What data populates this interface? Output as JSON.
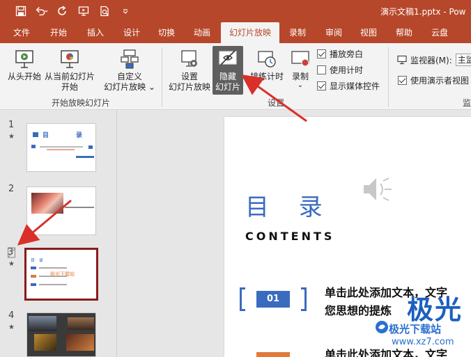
{
  "window": {
    "title": "演示文稿1.pptx  -  Pow"
  },
  "tabs": [
    {
      "label": "文件"
    },
    {
      "label": "开始"
    },
    {
      "label": "插入"
    },
    {
      "label": "设计"
    },
    {
      "label": "切换"
    },
    {
      "label": "动画"
    },
    {
      "label": "幻灯片放映",
      "active": true
    },
    {
      "label": "录制"
    },
    {
      "label": "审阅"
    },
    {
      "label": "视图"
    },
    {
      "label": "帮助"
    },
    {
      "label": "云盘"
    }
  ],
  "ribbon": {
    "from_start": "从头开始",
    "from_current_line1": "从当前幻灯片",
    "from_current_line2": "开始",
    "custom_line1": "自定义",
    "custom_line2": "幻灯片放映 ⌄",
    "group_start_label": "开始放映幻灯片",
    "setup_line1": "设置",
    "setup_line2": "幻灯片放映",
    "hide_line1": "隐藏",
    "hide_line2": "幻灯片",
    "rehearse": "排练计时",
    "record": "录制",
    "record_arrow": "⌄",
    "play_narration": "播放旁白",
    "use_timings": "使用计时",
    "show_media_controls": "显示媒体控件",
    "group_setup_label": "设置",
    "monitor_label": "监视器(M):",
    "monitor_value": "主监",
    "presenter_view": "使用演示者视图",
    "group_monitor_label": "监"
  },
  "checkboxes": {
    "play_narration": true,
    "use_timings": false,
    "show_media_controls": true,
    "presenter_view": true
  },
  "thumbnails": [
    {
      "number": "1",
      "star": "★"
    },
    {
      "number": "2",
      "star": ""
    },
    {
      "number": "3",
      "star": "★",
      "hidden": true
    },
    {
      "number": "4",
      "star": "★"
    }
  ],
  "slide": {
    "title": "目 录",
    "subtitle": "CONTENTS",
    "item1_number": "01",
    "item1_line1": "单击此处添加文本，文字",
    "item1_line2": "您思想的提炼",
    "item2_line1": "单击此处添加文本，文字"
  },
  "thumb1": {
    "title_a": "目",
    "title_b": "录"
  },
  "thumb3": {
    "title": "目 录",
    "overlay": "极光下载站"
  },
  "watermark": {
    "big": "极光",
    "sub": "极光下载站",
    "url": "www.xz7.com"
  },
  "colors": {
    "brand": "#b7472a",
    "accent_blue": "#3a6bbf",
    "selected_border": "#8a1b1b",
    "arrow_red": "#d9302a"
  }
}
